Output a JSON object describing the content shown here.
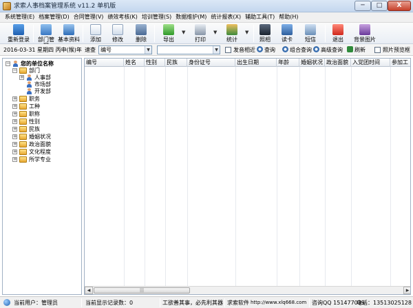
{
  "window": {
    "title": "求索人事档案管理系统 v11.2 单机版",
    "minimize": "─",
    "maximize": "□",
    "close": "X"
  },
  "menu": [
    "系统管理(E)",
    "档案管理(D)",
    "合同管理(V)",
    "绩效考核(K)",
    "培训管理(S)",
    "数据维护(M)",
    "统计报表(X)",
    "辅助工具(T)",
    "帮助(H)"
  ],
  "toolbar": {
    "relogin": "重新登录",
    "dept": "部门管理",
    "basic": "基本资料",
    "add": "添加",
    "edit": "修改",
    "delete": "删除",
    "export": "导出",
    "print": "打印",
    "stats": "统计",
    "photo": "照相",
    "readcard": "读卡",
    "sms": "短信",
    "exit": "退出",
    "bg": "背景图片"
  },
  "search": {
    "date": "2016-03-31 星期四 丙申(猴)年",
    "speed_label": "速查",
    "field": "编号",
    "value": "",
    "fuzzy_label": "发音相近",
    "query": "查询",
    "combo_query": "组合查询",
    "advanced_query": "高级查询",
    "refresh": "刷新",
    "photo_preview": "照片预览框"
  },
  "tree": {
    "root": "您的单位名称",
    "department": "部门",
    "sub_departments": [
      "人事部",
      "市场部",
      "开发部"
    ],
    "categories": [
      "职务",
      "工种",
      "职称",
      "性别",
      "民族",
      "婚姻状况",
      "政治面貌",
      "文化程度",
      "所学专业"
    ]
  },
  "grid": {
    "columns": [
      "编号",
      "姓名",
      "性别",
      "民族",
      "身份证号",
      "出生日期",
      "年龄",
      "婚姻状况",
      "政治面貌",
      "入党团时间",
      "参加工"
    ]
  },
  "scroll": {
    "left": "◀",
    "right": "▶",
    "thumb": "|||"
  },
  "status": {
    "user": "当前用户：管理员",
    "records": "当前显示记录数：0",
    "slogan": "工欲善其事，必先利其器",
    "vendor": "求索软件",
    "url": "http://www.xlq668.com",
    "qq": "咨询QQ 151477039",
    "phone": "电话：13513025128"
  }
}
